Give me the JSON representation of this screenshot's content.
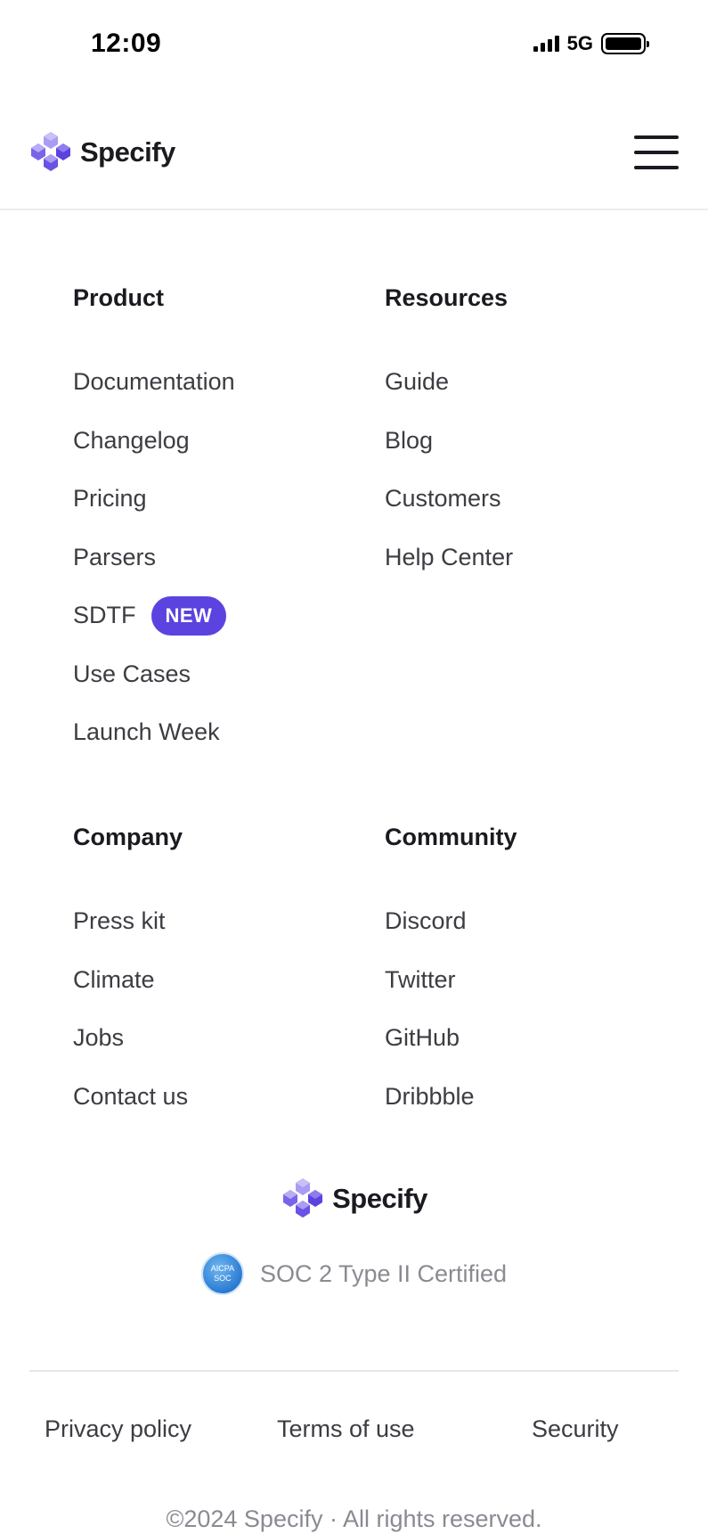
{
  "status_bar": {
    "time": "12:09",
    "network": "5G"
  },
  "header": {
    "logo_text": "Specify",
    "menu_icon": "hamburger-icon"
  },
  "columns": {
    "product": {
      "title": "Product",
      "links": [
        "Documentation",
        "Changelog",
        "Pricing",
        "Parsers",
        "SDTF",
        "Use Cases",
        "Launch Week"
      ],
      "badge": "NEW"
    },
    "resources": {
      "title": "Resources",
      "links": [
        "Guide",
        "Blog",
        "Customers",
        "Help Center"
      ]
    },
    "company": {
      "title": "Company",
      "links": [
        "Press kit",
        "Climate",
        "Jobs",
        "Contact us"
      ]
    },
    "community": {
      "title": "Community",
      "links": [
        "Discord",
        "Twitter",
        "GitHub",
        "Dribbble"
      ]
    }
  },
  "brand": {
    "logo_text": "Specify"
  },
  "soc": {
    "badge_line1": "AICPA",
    "badge_line2": "SOC",
    "text": "SOC 2 Type II Certified"
  },
  "legal": {
    "privacy": "Privacy policy",
    "terms": "Terms of use",
    "security": "Security"
  },
  "copyright": "©2024 Specify · All rights reserved.",
  "colors": {
    "accent": "#5b43df",
    "logo_light": "#a99cf3",
    "logo_dark": "#5b43df",
    "text": "#3c3c42",
    "muted": "#8a8a92"
  }
}
